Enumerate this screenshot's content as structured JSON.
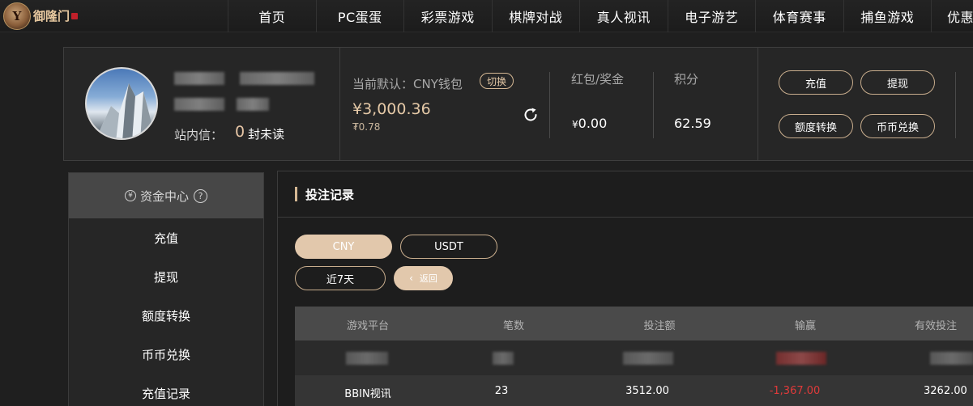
{
  "logo": {
    "text": "御隆门",
    "mark": "Y"
  },
  "nav": [
    "首页",
    "PC蛋蛋",
    "彩票游戏",
    "棋牌对战",
    "真人视讯",
    "电子游艺",
    "体育赛事",
    "捕鱼游戏",
    "优惠"
  ],
  "account": {
    "inbox_label": "站内信：",
    "inbox_count": "0",
    "inbox_unit": "封未读",
    "wallet_label": "当前默认：CNY钱包",
    "switch_label": "切换",
    "balance": "¥3,000.36",
    "balance_sub": "₮0.78",
    "bonus_label": "红包/奖金",
    "bonus_currency": "¥",
    "bonus_value": "0.00",
    "points_label": "积分",
    "points_value": "62.59",
    "actions": [
      "充值",
      "提现",
      "额度转换",
      "币币兑换"
    ]
  },
  "sidemenu": {
    "header": "资金中心",
    "items": [
      "充值",
      "提现",
      "额度转换",
      "币币兑换",
      "充值记录"
    ]
  },
  "content": {
    "title": "投注记录",
    "currency_tabs": [
      "CNY",
      "USDT"
    ],
    "period_tab": "近7天",
    "back_label": "返回",
    "columns": [
      "游戏平台",
      "笔数",
      "投注额",
      "输赢",
      "有效投注"
    ],
    "rows": [
      {
        "platform": "BBIN视讯",
        "count": "23",
        "bet": "3512.00",
        "winloss": "-1,367.00",
        "valid": "3262.00"
      }
    ]
  },
  "colors": {
    "accent": "#e2c8ac",
    "negative": "#e03a3a",
    "background": "#1f1f1f"
  }
}
